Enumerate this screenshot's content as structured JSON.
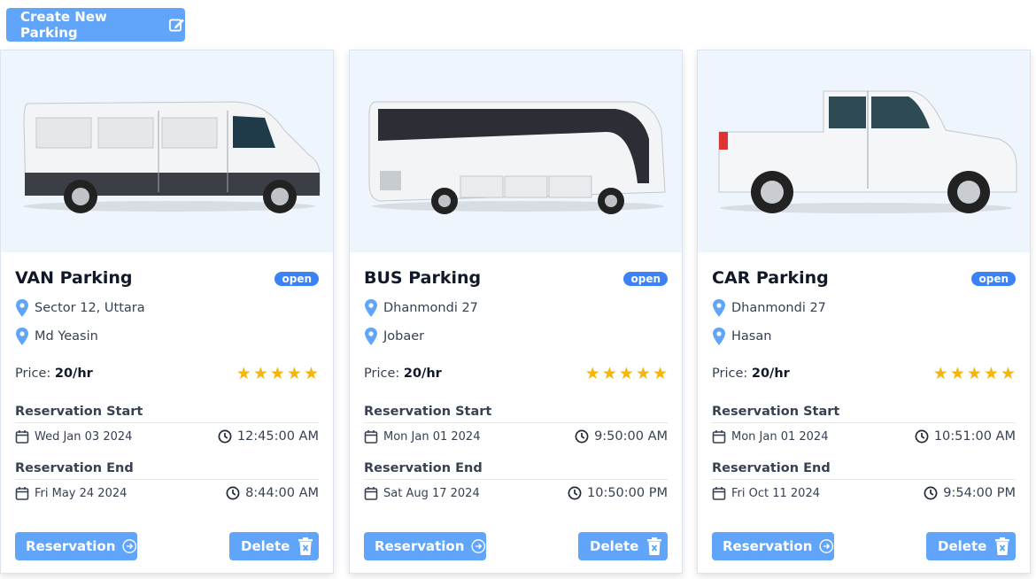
{
  "toolbar": {
    "create_label": "Create New Parking",
    "create_icon": "edit-icon"
  },
  "labels": {
    "price": "Price:",
    "reservation_start": "Reservation Start",
    "reservation_end": "Reservation End",
    "reservation_button": "Reservation",
    "delete_button": "Delete"
  },
  "colors": {
    "accent": "#60a5fa",
    "badge": "#3b82f6",
    "star": "#f5b50a",
    "image_bg": "#eef5fd"
  },
  "cards": [
    {
      "title": "VAN Parking",
      "status": "open",
      "location": "Sector 12, Uttara",
      "owner": "Md Yeasin",
      "price": "20/hr",
      "rating": 5,
      "start_date": "Wed Jan 03 2024",
      "start_time": "12:45:00 AM",
      "end_date": "Fri May 24 2024",
      "end_time": "8:44:00 AM"
    },
    {
      "title": "BUS Parking",
      "status": "open",
      "location": "Dhanmondi 27",
      "owner": "Jobaer",
      "price": "20/hr",
      "rating": 5,
      "start_date": "Mon Jan 01 2024",
      "start_time": "9:50:00 AM",
      "end_date": "Sat Aug 17 2024",
      "end_time": "10:50:00 PM"
    },
    {
      "title": "CAR Parking",
      "status": "open",
      "location": "Dhanmondi 27",
      "owner": "Hasan",
      "price": "20/hr",
      "rating": 5,
      "start_date": "Mon Jan 01 2024",
      "start_time": "10:51:00 AM",
      "end_date": "Fri Oct 11 2024",
      "end_time": "9:54:00 PM"
    }
  ]
}
